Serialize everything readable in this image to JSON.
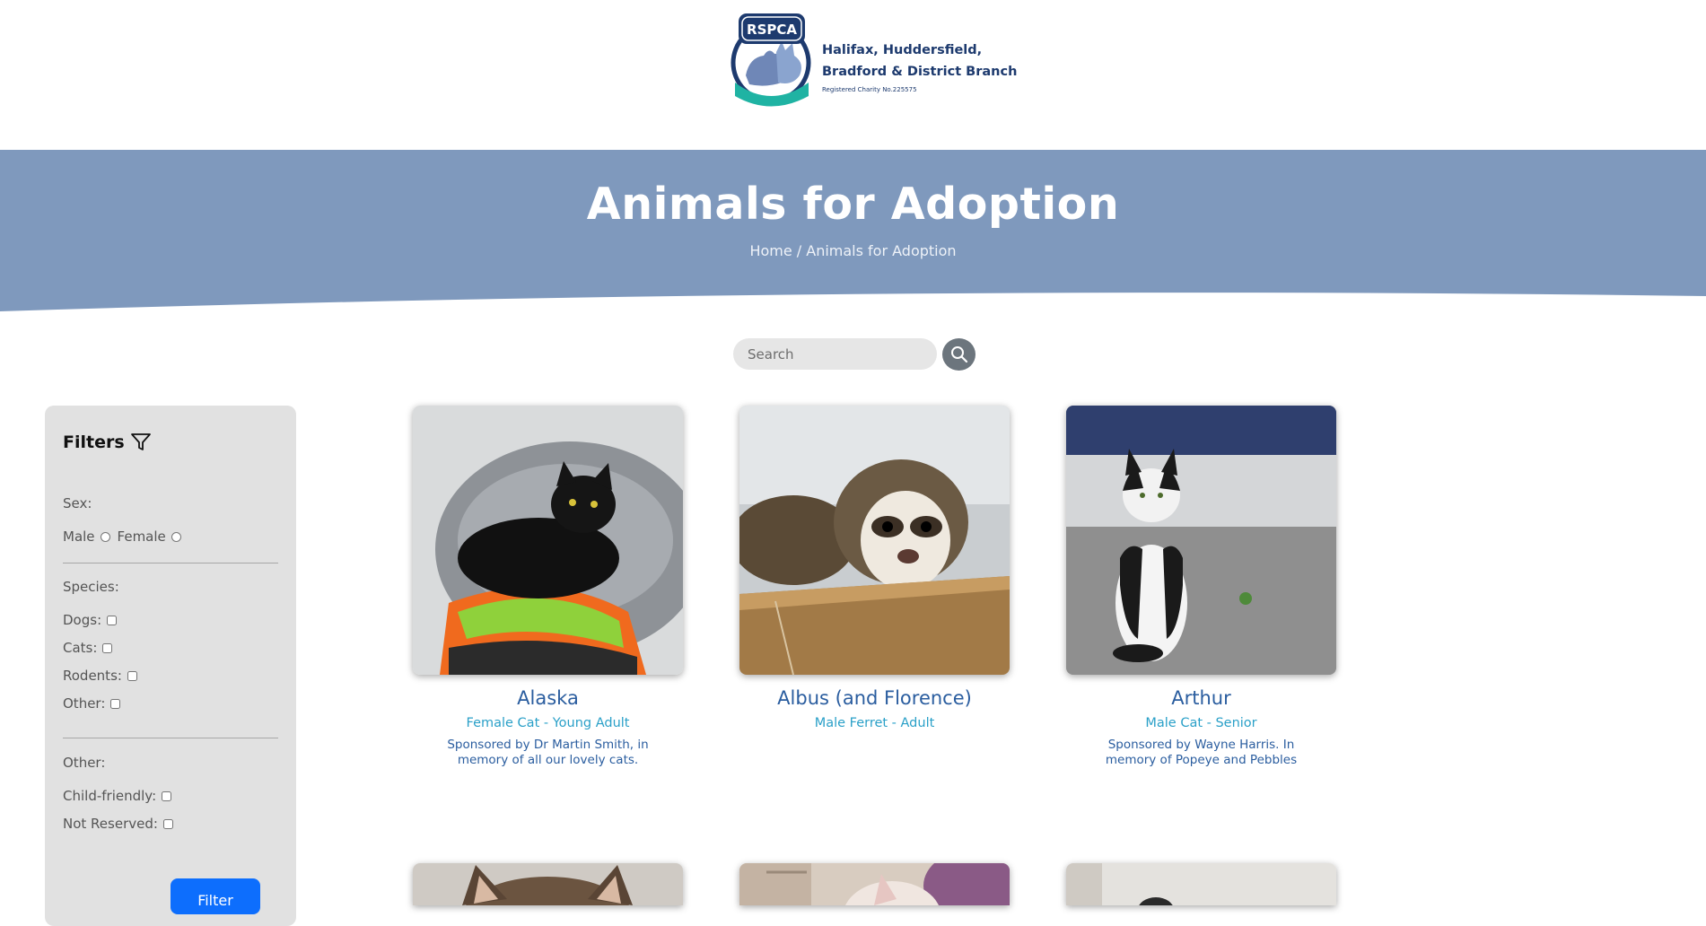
{
  "logo": {
    "badge_text": "RSPCA",
    "line1": "Halifax, Huddersfield,",
    "line2": "Bradford & District Branch",
    "line3": "Registered Charity No.225575"
  },
  "hero": {
    "title": "Animals for Adoption",
    "breadcrumb_home": "Home",
    "breadcrumb_sep": " / ",
    "breadcrumb_current": "Animals for Adoption"
  },
  "search": {
    "placeholder": "Search",
    "icon": "search-icon"
  },
  "filters": {
    "title": "Filters",
    "icon": "funnel-icon",
    "sex_label": "Sex:",
    "male": "Male",
    "female": "Female",
    "species_label": "Species:",
    "dogs": "Dogs:",
    "cats": "Cats:",
    "rodents": "Rodents:",
    "other_species": "Other:",
    "other_label": "Other:",
    "child_friendly": "Child-friendly:",
    "not_reserved": "Not Reserved:",
    "button": "Filter"
  },
  "animals": [
    {
      "name": "Alaska",
      "details": "Female Cat - Young Adult",
      "sponsor": "Sponsored by Dr Martin Smith, in memory of all our lovely cats."
    },
    {
      "name": "Albus (and Florence)",
      "details": "Male Ferret - Adult",
      "sponsor": ""
    },
    {
      "name": "Arthur",
      "details": "Male Cat - Senior",
      "sponsor": "Sponsored by Wayne Harris. In memory of Popeye and Pebbles"
    }
  ],
  "colors": {
    "hero_blue": "#7f99bd",
    "link_blue": "#2a5d9f",
    "teal": "#2aa0c8",
    "filter_button": "#0d6efd"
  }
}
